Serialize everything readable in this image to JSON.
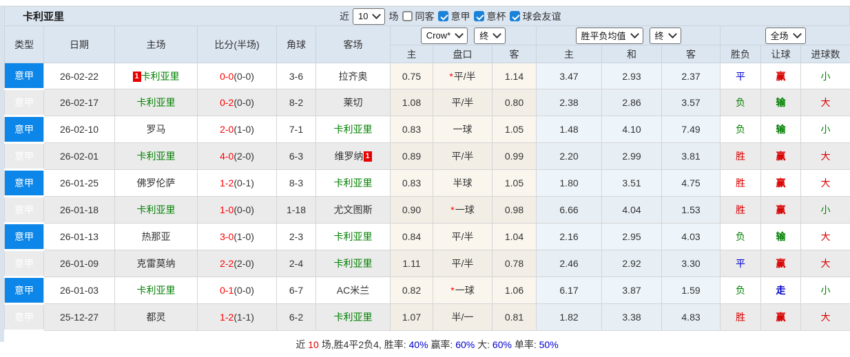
{
  "topbar": {
    "title": "卡利亚里",
    "recent_label": "近",
    "recent_value": "10",
    "unit_label": "场",
    "filters": [
      {
        "label": "同客",
        "checked": false
      },
      {
        "label": "意甲",
        "checked": true
      },
      {
        "label": "意杯",
        "checked": true
      },
      {
        "label": "球会友谊",
        "checked": true
      }
    ]
  },
  "controls": {
    "odds_company": "Crow*",
    "odds_state": "终",
    "avg_name": "胜平负均值",
    "avg_state": "终",
    "scope": "全场"
  },
  "columns": {
    "type": "类型",
    "date": "日期",
    "home": "主场",
    "score": "比分(半场)",
    "corners": "角球",
    "away": "客场",
    "sub": [
      "主",
      "盘口",
      "客",
      "主",
      "和",
      "客",
      "胜负",
      "让球",
      "进球数"
    ]
  },
  "colors": {
    "accent_blue": "#0c86e8",
    "team_green": "#008000",
    "score_red": "#ff0000",
    "result_red": "#d90000",
    "result_blue": "#0000cc",
    "result_green": "#008000",
    "header_bg": "#dce6f1",
    "row_alt": "#ebebeb",
    "odds_col_bg": "#faf6ed",
    "avg_col_bg": "#eef5fa",
    "badge_red": "#e60000"
  },
  "rows": [
    {
      "league": "意甲",
      "date": "26-02-22",
      "home": {
        "badge_before": "1",
        "name": "卡利亚里",
        "color": "green"
      },
      "score": {
        "main": "0-0",
        "half": "(0-0)"
      },
      "corners": "3-6",
      "away": {
        "name": "拉齐奥",
        "color": "black"
      },
      "odds": {
        "home": "0.75",
        "line_star": "*",
        "line": "平/半",
        "away": "1.14"
      },
      "avg": {
        "home": "3.47",
        "draw": "2.93",
        "away": "2.37"
      },
      "results": {
        "outcome": {
          "text": "平",
          "color": "blue"
        },
        "handicap": {
          "text": "赢",
          "color": "red"
        },
        "goals": {
          "text": "小",
          "color": "green"
        }
      }
    },
    {
      "league": "意甲",
      "date": "26-02-17",
      "home": {
        "name": "卡利亚里",
        "color": "green"
      },
      "score": {
        "main": "0-2",
        "half": "(0-0)"
      },
      "corners": "8-2",
      "away": {
        "name": "莱切",
        "color": "black"
      },
      "odds": {
        "home": "1.08",
        "line_star": "",
        "line": "平/半",
        "away": "0.80"
      },
      "avg": {
        "home": "2.38",
        "draw": "2.86",
        "away": "3.57"
      },
      "results": {
        "outcome": {
          "text": "负",
          "color": "green"
        },
        "handicap": {
          "text": "输",
          "color": "green"
        },
        "goals": {
          "text": "大",
          "color": "red"
        }
      }
    },
    {
      "league": "意甲",
      "date": "26-02-10",
      "home": {
        "name": "罗马",
        "color": "black"
      },
      "score": {
        "main": "2-0",
        "half": "(1-0)"
      },
      "corners": "7-1",
      "away": {
        "name": "卡利亚里",
        "color": "green"
      },
      "odds": {
        "home": "0.83",
        "line_star": "",
        "line": "一球",
        "away": "1.05"
      },
      "avg": {
        "home": "1.48",
        "draw": "4.10",
        "away": "7.49"
      },
      "results": {
        "outcome": {
          "text": "负",
          "color": "green"
        },
        "handicap": {
          "text": "输",
          "color": "green"
        },
        "goals": {
          "text": "小",
          "color": "green"
        }
      }
    },
    {
      "league": "意甲",
      "date": "26-02-01",
      "home": {
        "name": "卡利亚里",
        "color": "green"
      },
      "score": {
        "main": "4-0",
        "half": "(2-0)"
      },
      "corners": "6-3",
      "away": {
        "name": "维罗纳",
        "color": "black",
        "badge_after": "1"
      },
      "odds": {
        "home": "0.89",
        "line_star": "",
        "line": "平/半",
        "away": "0.99"
      },
      "avg": {
        "home": "2.20",
        "draw": "2.99",
        "away": "3.81"
      },
      "results": {
        "outcome": {
          "text": "胜",
          "color": "red"
        },
        "handicap": {
          "text": "赢",
          "color": "red"
        },
        "goals": {
          "text": "大",
          "color": "red"
        }
      }
    },
    {
      "league": "意甲",
      "date": "26-01-25",
      "home": {
        "name": "佛罗伦萨",
        "color": "black"
      },
      "score": {
        "main": "1-2",
        "half": "(0-1)"
      },
      "corners": "8-3",
      "away": {
        "name": "卡利亚里",
        "color": "green"
      },
      "odds": {
        "home": "0.83",
        "line_star": "",
        "line": "半球",
        "away": "1.05"
      },
      "avg": {
        "home": "1.80",
        "draw": "3.51",
        "away": "4.75"
      },
      "results": {
        "outcome": {
          "text": "胜",
          "color": "red"
        },
        "handicap": {
          "text": "赢",
          "color": "red"
        },
        "goals": {
          "text": "大",
          "color": "red"
        }
      }
    },
    {
      "league": "意甲",
      "date": "26-01-18",
      "home": {
        "name": "卡利亚里",
        "color": "green"
      },
      "score": {
        "main": "1-0",
        "half": "(0-0)"
      },
      "corners": "1-18",
      "away": {
        "name": "尤文图斯",
        "color": "black"
      },
      "odds": {
        "home": "0.90",
        "line_star": "*",
        "line": "一球",
        "away": "0.98"
      },
      "avg": {
        "home": "6.66",
        "draw": "4.04",
        "away": "1.53"
      },
      "results": {
        "outcome": {
          "text": "胜",
          "color": "red"
        },
        "handicap": {
          "text": "赢",
          "color": "red"
        },
        "goals": {
          "text": "小",
          "color": "green"
        }
      }
    },
    {
      "league": "意甲",
      "date": "26-01-13",
      "home": {
        "name": "热那亚",
        "color": "black"
      },
      "score": {
        "main": "3-0",
        "half": "(1-0)"
      },
      "corners": "2-3",
      "away": {
        "name": "卡利亚里",
        "color": "green"
      },
      "odds": {
        "home": "0.84",
        "line_star": "",
        "line": "平/半",
        "away": "1.04"
      },
      "avg": {
        "home": "2.16",
        "draw": "2.95",
        "away": "4.03"
      },
      "results": {
        "outcome": {
          "text": "负",
          "color": "green"
        },
        "handicap": {
          "text": "输",
          "color": "green"
        },
        "goals": {
          "text": "大",
          "color": "red"
        }
      }
    },
    {
      "league": "意甲",
      "date": "26-01-09",
      "home": {
        "name": "克雷莫纳",
        "color": "black"
      },
      "score": {
        "main": "2-2",
        "half": "(2-0)"
      },
      "corners": "2-4",
      "away": {
        "name": "卡利亚里",
        "color": "green"
      },
      "odds": {
        "home": "1.11",
        "line_star": "",
        "line": "平/半",
        "away": "0.78"
      },
      "avg": {
        "home": "2.46",
        "draw": "2.92",
        "away": "3.30"
      },
      "results": {
        "outcome": {
          "text": "平",
          "color": "blue"
        },
        "handicap": {
          "text": "赢",
          "color": "red"
        },
        "goals": {
          "text": "大",
          "color": "red"
        }
      }
    },
    {
      "league": "意甲",
      "date": "26-01-03",
      "home": {
        "name": "卡利亚里",
        "color": "green"
      },
      "score": {
        "main": "0-1",
        "half": "(0-0)"
      },
      "corners": "6-7",
      "away": {
        "name": "AC米兰",
        "color": "black"
      },
      "odds": {
        "home": "0.82",
        "line_star": "*",
        "line": "一球",
        "away": "1.06"
      },
      "avg": {
        "home": "6.17",
        "draw": "3.87",
        "away": "1.59"
      },
      "results": {
        "outcome": {
          "text": "负",
          "color": "green"
        },
        "handicap": {
          "text": "走",
          "color": "blue"
        },
        "goals": {
          "text": "小",
          "color": "green"
        }
      }
    },
    {
      "league": "意甲",
      "date": "25-12-27",
      "home": {
        "name": "都灵",
        "color": "black"
      },
      "score": {
        "main": "1-2",
        "half": "(1-1)"
      },
      "corners": "6-2",
      "away": {
        "name": "卡利亚里",
        "color": "green"
      },
      "odds": {
        "home": "1.07",
        "line_star": "",
        "line": "半/一",
        "away": "0.81"
      },
      "avg": {
        "home": "1.82",
        "draw": "3.38",
        "away": "4.83"
      },
      "results": {
        "outcome": {
          "text": "胜",
          "color": "red"
        },
        "handicap": {
          "text": "赢",
          "color": "red"
        },
        "goals": {
          "text": "大",
          "color": "red"
        }
      }
    }
  ],
  "footer": {
    "segments": [
      {
        "text": "近",
        "color": "black"
      },
      {
        "text": "10",
        "color": "red"
      },
      {
        "text": "场,胜4平2负4, 胜率:",
        "color": "black"
      },
      {
        "text": "40%",
        "color": "blue"
      },
      {
        "text": " 赢率:",
        "color": "black"
      },
      {
        "text": "60%",
        "color": "blue"
      },
      {
        "text": " 大:",
        "color": "black"
      },
      {
        "text": "60%",
        "color": "blue"
      },
      {
        "text": " 单率:",
        "color": "black"
      },
      {
        "text": "50%",
        "color": "blue"
      }
    ]
  }
}
